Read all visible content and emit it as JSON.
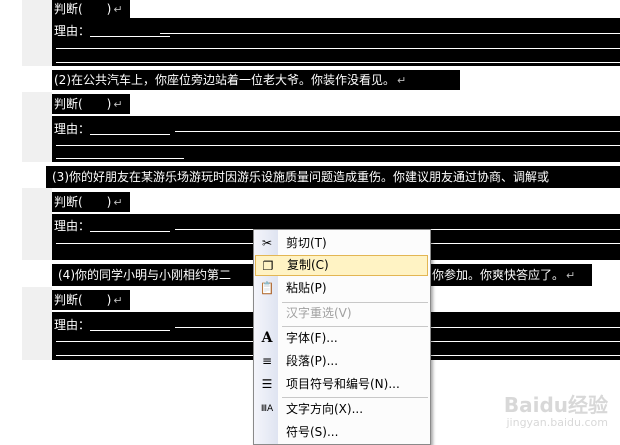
{
  "document": {
    "q1": {
      "judge": "判断(　　)",
      "reason": "理由："
    },
    "q2": {
      "title": "(2)在公共汽车上，你座位旁边站着一位老大爷。你装作没看见。",
      "judge": "判断(　　)",
      "reason": "理由："
    },
    "q3": {
      "title": "(3)你的好朋友在某游乐场游玩时因游乐设施质量问题造成重伤。你建议朋友通过协商、调解或",
      "judge": "判断(　　)",
      "reason": "理由："
    },
    "q4": {
      "title_start": "(4)你的同学小明与小刚相约第二",
      "title_end": "你参加。你爽快答应了。",
      "judge": "判断(　　)",
      "reason": "理由："
    },
    "para_mark": "↵"
  },
  "context_menu": {
    "items": [
      {
        "label": "剪切(T)",
        "icon": "scissors-icon",
        "glyph": "✂",
        "state": "normal"
      },
      {
        "label": "复制(C)",
        "icon": "copy-icon",
        "glyph": "❐",
        "state": "highlighted"
      },
      {
        "label": "粘贴(P)",
        "icon": "paste-icon",
        "glyph": "📋",
        "state": "normal"
      },
      {
        "label": "汉字重选(V)",
        "icon": "",
        "glyph": "",
        "state": "disabled"
      },
      {
        "label": "字体(F)...",
        "icon": "font-icon",
        "glyph": "A",
        "state": "normal"
      },
      {
        "label": "段落(P)...",
        "icon": "paragraph-icon",
        "glyph": "≡",
        "state": "normal"
      },
      {
        "label": "项目符号和编号(N)...",
        "icon": "bullets-icon",
        "glyph": "☰",
        "state": "normal"
      },
      {
        "label": "文字方向(X)...",
        "icon": "text-direction-icon",
        "glyph": "ⅢA",
        "state": "normal"
      },
      {
        "label": "符号(S)...",
        "icon": "",
        "glyph": "",
        "state": "normal"
      }
    ]
  },
  "watermark": {
    "brand": "Baidu经验",
    "sub": "jingyan.baidu.com"
  },
  "colors": {
    "selection": "#000000",
    "highlight": "#fff3c4",
    "highlight_border": "#e3b653"
  }
}
